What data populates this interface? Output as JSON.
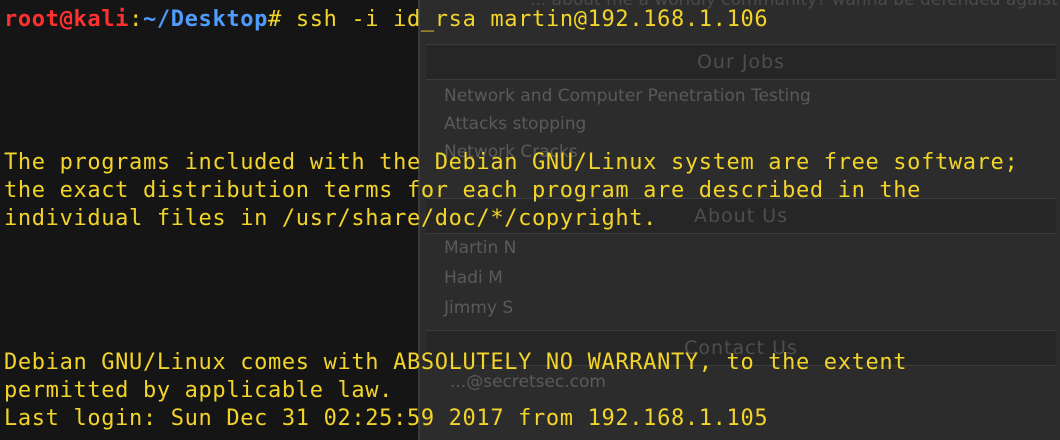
{
  "ghost_window": {
    "top_text": "... about me a worldly community? wanna be defended agaist Cyb",
    "jobs_heading": "Our Jobs",
    "jobs": [
      "Network and Computer Penetration Testing",
      "Attacks stopping",
      "Network Cracks"
    ],
    "about_heading": "About Us",
    "team": [
      "Martin N",
      "Hadi M",
      "Jimmy S"
    ],
    "contact_heading": "Contact Us",
    "contact_email": "...@secretsec.com"
  },
  "terminal": {
    "top_partial": "--- .. . ... .... .... ....",
    "prompt": {
      "user_host": "root@kali",
      "separator": ":",
      "path": "~/Desktop",
      "symbol": "#",
      "command": " ssh -i id_rsa martin@192.168.1.106"
    },
    "lines": [
      "The programs included with the Debian GNU/Linux system are free software;",
      "the exact distribution terms for each program are described in the",
      "individual files in /usr/share/doc/*/copyright.",
      "Debian GNU/Linux comes with ABSOLUTELY NO WARRANTY, to the extent",
      "permitted by applicable law.",
      "Last login: Sun Dec 31 02:25:59 2017 from 192.168.1.105"
    ]
  },
  "colors": {
    "text": "#f2d42a",
    "user_host": "#ff3030",
    "path": "#4f9cff",
    "background": "#151515"
  }
}
